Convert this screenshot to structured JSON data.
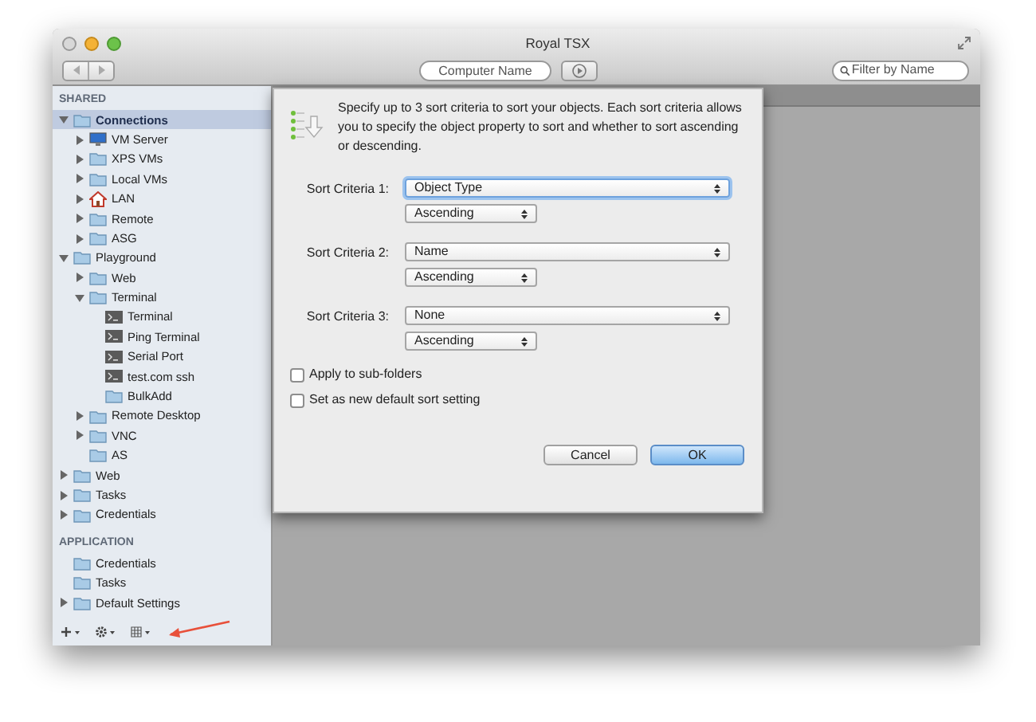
{
  "window": {
    "title": "Royal TSX"
  },
  "toolbar": {
    "computer_name": {
      "placeholder": "Computer Name"
    },
    "filter": {
      "placeholder": "Filter by Name"
    }
  },
  "sidebar": {
    "sections": [
      {
        "title": "SHARED",
        "items": [
          {
            "label": "Connections",
            "kind": "folder",
            "expanded": true,
            "selected": true,
            "children": [
              {
                "label": "VM Server",
                "kind": "monitor",
                "expanded": false,
                "selected": false
              },
              {
                "label": "XPS VMs",
                "kind": "folder",
                "expanded": false,
                "selected": false
              },
              {
                "label": "Local VMs",
                "kind": "folder",
                "expanded": false,
                "selected": false
              },
              {
                "label": "LAN",
                "kind": "house",
                "expanded": false,
                "selected": false
              },
              {
                "label": "Remote",
                "kind": "folder",
                "expanded": false,
                "selected": false
              },
              {
                "label": "ASG",
                "kind": "folder",
                "expanded": false,
                "selected": false
              }
            ]
          },
          {
            "label": "Playground",
            "kind": "folder",
            "expanded": true,
            "selected": false,
            "children": [
              {
                "label": "Web",
                "kind": "folder",
                "expanded": false,
                "selected": false
              },
              {
                "label": "Terminal",
                "kind": "folder",
                "expanded": true,
                "selected": false,
                "children": [
                  {
                    "label": "Terminal",
                    "kind": "terminal",
                    "selected": false
                  },
                  {
                    "label": "Ping Terminal",
                    "kind": "terminal",
                    "selected": false
                  },
                  {
                    "label": "Serial Port",
                    "kind": "terminal",
                    "selected": false
                  },
                  {
                    "label": "test.com ssh",
                    "kind": "terminal",
                    "selected": false
                  },
                  {
                    "label": "BulkAdd",
                    "kind": "folder",
                    "selected": false
                  }
                ]
              },
              {
                "label": "Remote Desktop",
                "kind": "folder",
                "expanded": false,
                "selected": false
              },
              {
                "label": "VNC",
                "kind": "folder",
                "expanded": false,
                "selected": false
              },
              {
                "label": "AS",
                "kind": "folder",
                "selected": false
              }
            ]
          },
          {
            "label": "Web",
            "kind": "folder",
            "expanded": false,
            "selected": false
          },
          {
            "label": "Tasks",
            "kind": "folder",
            "expanded": false,
            "selected": false
          },
          {
            "label": "Credentials",
            "kind": "folder",
            "expanded": false,
            "selected": false
          }
        ]
      },
      {
        "title": "APPLICATION",
        "items": [
          {
            "label": "Credentials",
            "kind": "folder",
            "selected": false
          },
          {
            "label": "Tasks",
            "kind": "folder",
            "selected": false
          },
          {
            "label": "Default Settings",
            "kind": "folder",
            "expanded": false,
            "selected": false
          }
        ]
      }
    ],
    "footer": [
      {
        "kind": "add"
      },
      {
        "kind": "gear"
      },
      {
        "kind": "grid"
      }
    ]
  },
  "dialog": {
    "description": "Specify up to 3 sort criteria to sort your objects. Each sort criteria allows you to specify the object property to sort and whether to sort ascending or descending.",
    "criteria": [
      {
        "label": "Sort Criteria 1:",
        "property": "Object Type",
        "order": "Ascending",
        "focused": true
      },
      {
        "label": "Sort Criteria 2:",
        "property": "Name",
        "order": "Ascending",
        "focused": false
      },
      {
        "label": "Sort Criteria 3:",
        "property": "None",
        "order": "Ascending",
        "focused": false
      }
    ],
    "options": [
      {
        "label": "Apply to sub-folders",
        "checked": false
      },
      {
        "label": "Set as new default sort setting",
        "checked": false
      }
    ],
    "buttons": [
      {
        "label": "Cancel",
        "default": false
      },
      {
        "label": "OK",
        "default": true
      }
    ]
  }
}
